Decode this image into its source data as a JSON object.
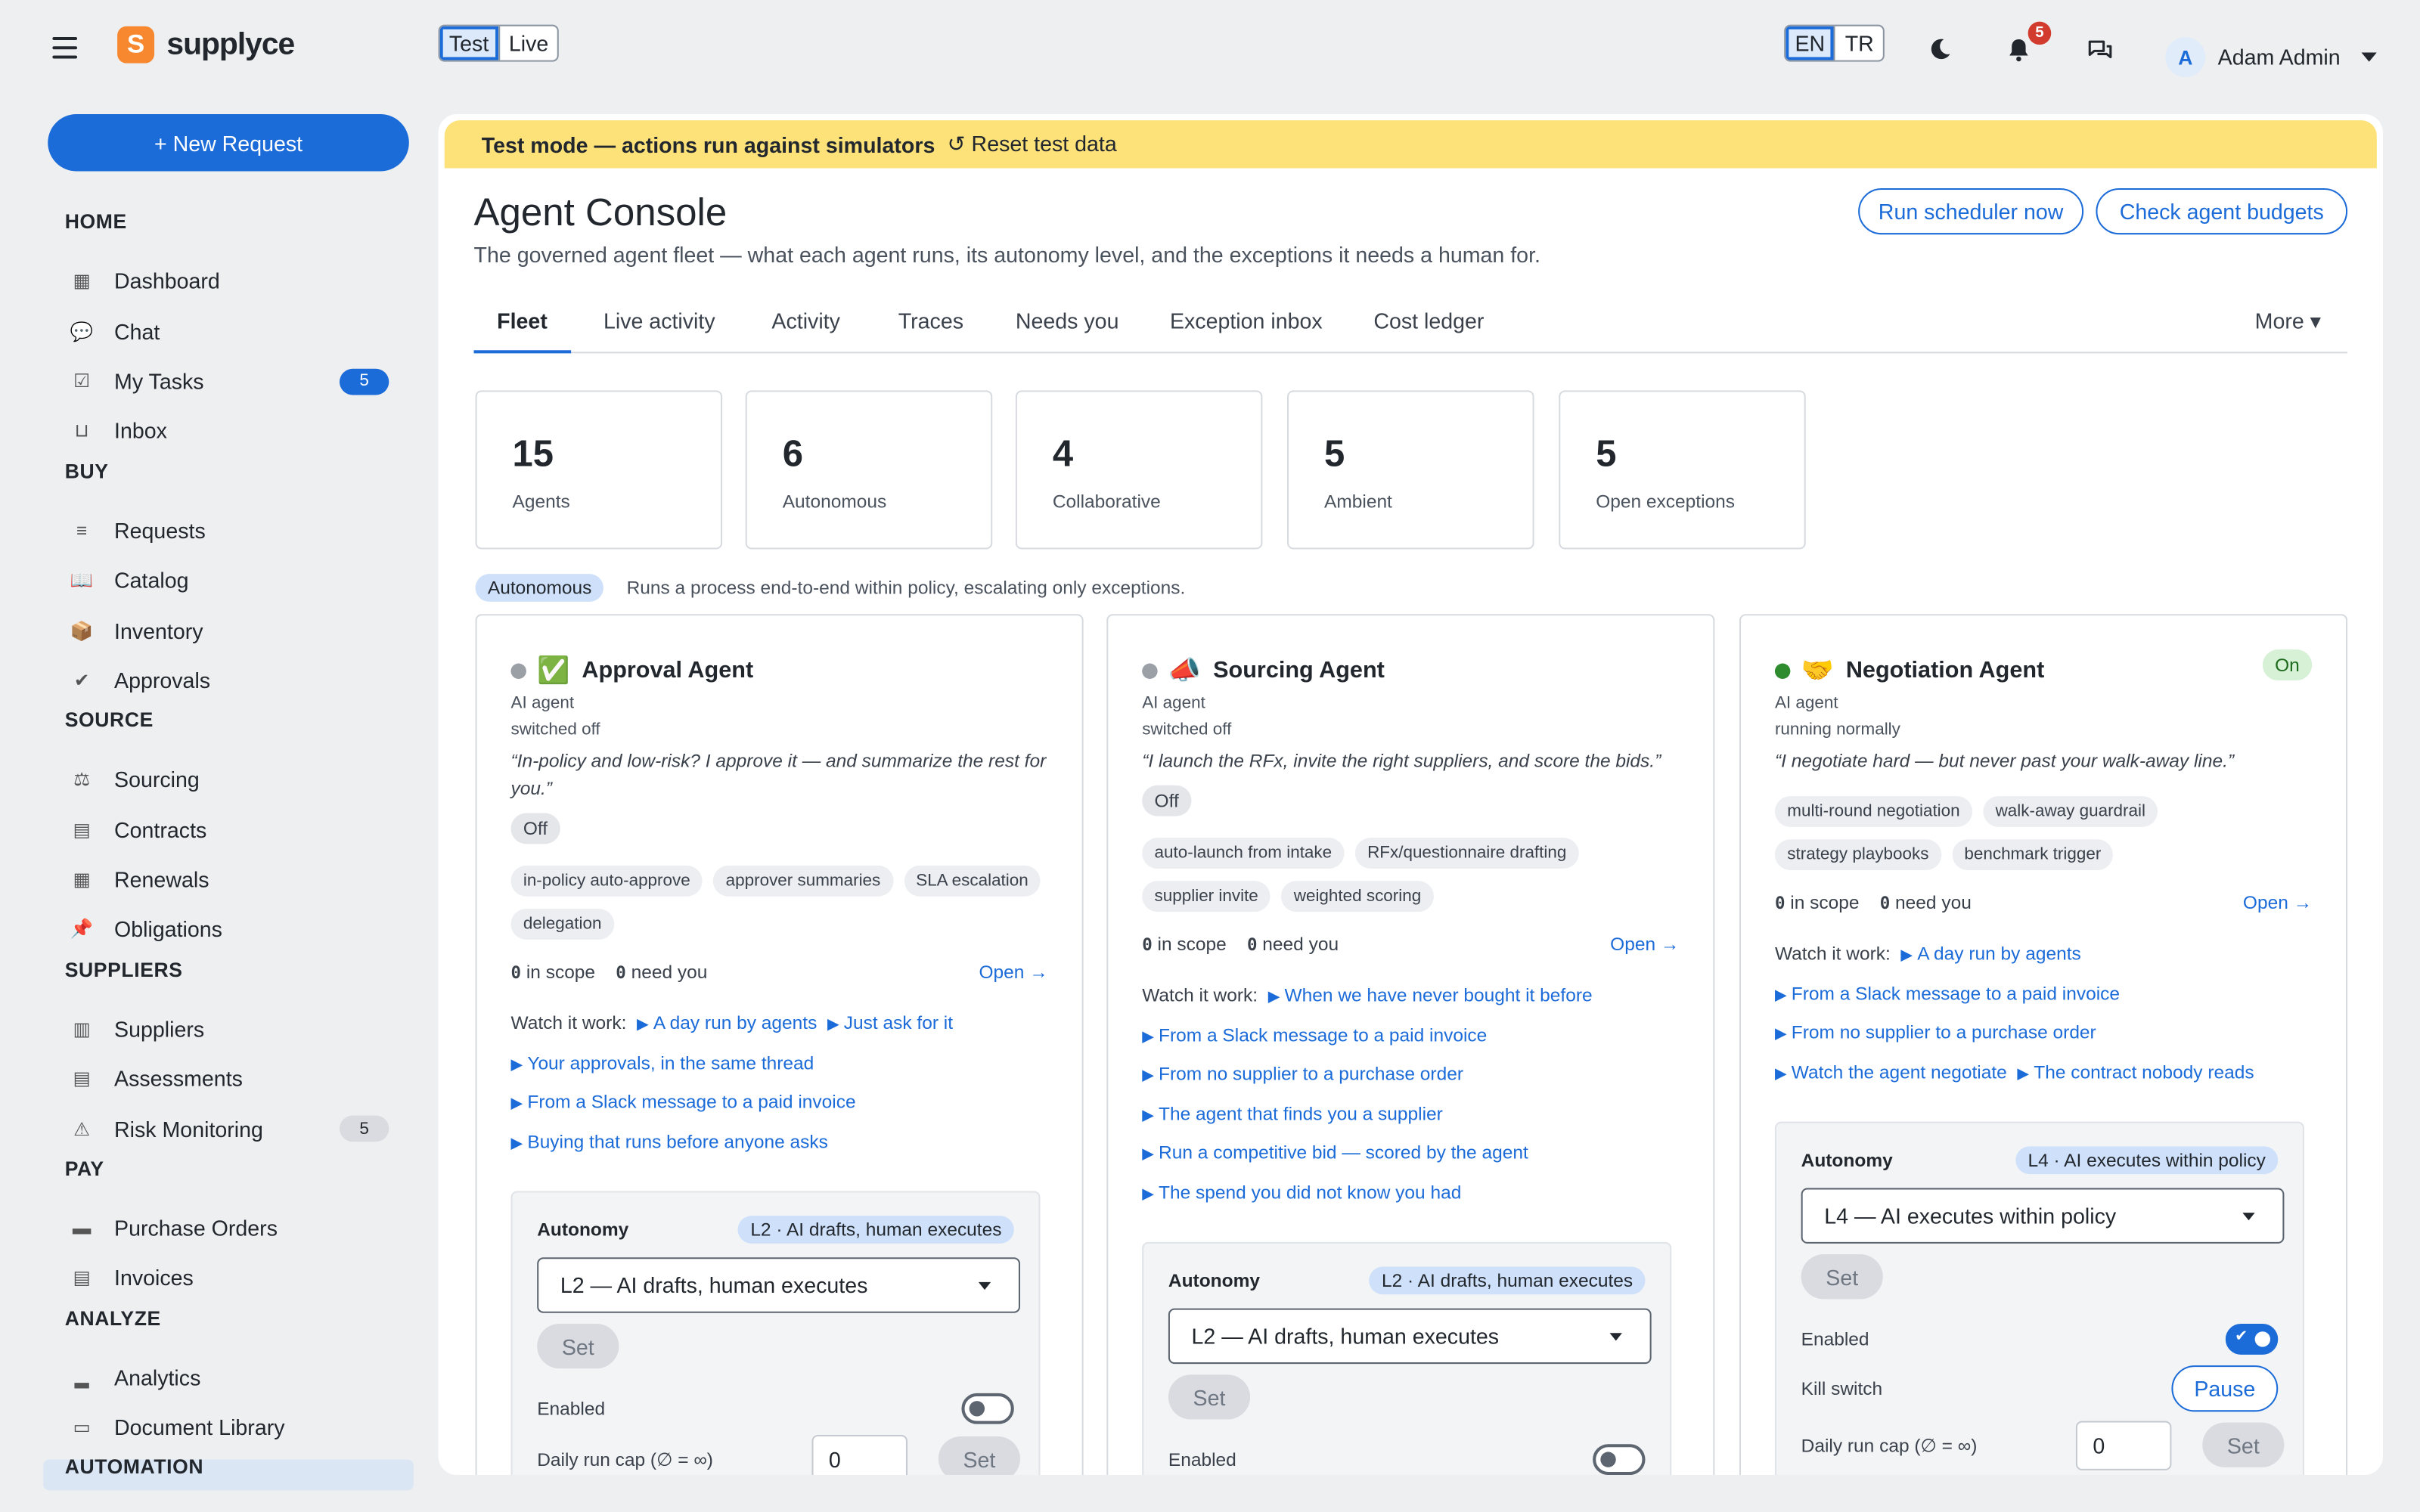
{
  "app": {
    "brand": "supplyce",
    "brand_letter": "S"
  },
  "topbar": {
    "env": [
      "Test",
      "Live"
    ],
    "lang": [
      "EN",
      "TR"
    ],
    "notification_count": "5",
    "user_initial": "A",
    "user_name": "Adam Admin"
  },
  "sidebar": {
    "new_request": "+ New Request",
    "sections": [
      {
        "heading": "HOME",
        "items": [
          {
            "label": "Dashboard",
            "icon": "grid-icon"
          },
          {
            "label": "Chat",
            "icon": "chat-icon"
          },
          {
            "label": "My Tasks",
            "icon": "checkbox-icon",
            "badge": "5"
          },
          {
            "label": "Inbox",
            "icon": "inbox-icon"
          }
        ]
      },
      {
        "heading": "BUY",
        "items": [
          {
            "label": "Requests",
            "icon": "list-icon"
          },
          {
            "label": "Catalog",
            "icon": "book-icon"
          },
          {
            "label": "Inventory",
            "icon": "box-icon"
          },
          {
            "label": "Approvals",
            "icon": "check-icon"
          }
        ]
      },
      {
        "heading": "SOURCE",
        "items": [
          {
            "label": "Sourcing",
            "icon": "scale-icon"
          },
          {
            "label": "Contracts",
            "icon": "document-icon"
          },
          {
            "label": "Renewals",
            "icon": "calendar-icon"
          },
          {
            "label": "Obligations",
            "icon": "pin-icon"
          }
        ]
      },
      {
        "heading": "SUPPLIERS",
        "items": [
          {
            "label": "Suppliers",
            "icon": "building-icon"
          },
          {
            "label": "Assessments",
            "icon": "clipboard-icon"
          },
          {
            "label": "Risk Monitoring",
            "icon": "warning-icon",
            "badge": "5"
          }
        ]
      },
      {
        "heading": "PAY",
        "items": [
          {
            "label": "Purchase Orders",
            "icon": "folder-icon"
          },
          {
            "label": "Invoices",
            "icon": "receipt-icon"
          }
        ]
      },
      {
        "heading": "ANALYZE",
        "items": [
          {
            "label": "Analytics",
            "icon": "bar-chart-icon"
          },
          {
            "label": "Document Library",
            "icon": "archive-icon"
          }
        ]
      },
      {
        "heading": "AUTOMATION",
        "items": []
      }
    ]
  },
  "banner": {
    "text": "Test mode — actions run against simulators",
    "reset": "↺ Reset test data"
  },
  "header": {
    "title": "Agent Console",
    "subtitle": "The governed agent fleet — what each agent runs, its autonomy level, and the exceptions it needs a human for.",
    "btn_scheduler": "Run scheduler now",
    "btn_budgets": "Check agent budgets"
  },
  "tabs": [
    "Fleet",
    "Live activity",
    "Activity",
    "Traces",
    "Needs you",
    "Exception inbox",
    "Cost ledger"
  ],
  "tab_more": "More ▾",
  "stats": [
    {
      "value": "15",
      "label": "Agents"
    },
    {
      "value": "6",
      "label": "Autonomous"
    },
    {
      "value": "4",
      "label": "Collaborative"
    },
    {
      "value": "5",
      "label": "Ambient"
    },
    {
      "value": "5",
      "label": "Open exceptions"
    }
  ],
  "group": {
    "pill": "Autonomous",
    "desc": "Runs a process end-to-end within policy, escalating only exceptions."
  },
  "common": {
    "ai_agent": "AI agent",
    "in_scope": " in scope",
    "need_you": " need you",
    "zero": "0",
    "open": "Open →",
    "watch": "Watch it work:",
    "autonomy": "Autonomy",
    "set": "Set",
    "enabled": "Enabled",
    "kill_switch": "Kill switch",
    "pause": "Pause",
    "daily_cap": "Daily run cap (∅ = ∞)",
    "cap_value": "0"
  },
  "agents": [
    {
      "name": "Approval Agent",
      "emoji": "✅",
      "status_color": "#9aa0a6",
      "status": "switched off",
      "quote": "“In-policy and low-risk? I approve it — and summarize the rest for you.”",
      "state_pill": "Off",
      "chips": [
        "in-policy auto-approve",
        "approver summaries",
        "SLA escalation",
        "delegation"
      ],
      "videos": [
        "A day run by agents",
        "Just ask for it",
        "Your approvals, in the same thread",
        "From a Slack message to a paid invoice",
        "Buying that runs before anyone asks"
      ],
      "level": "L2 · AI drafts, human executes",
      "select": "L2 — AI drafts, human executes"
    },
    {
      "name": "Sourcing Agent",
      "emoji": "📣",
      "status_color": "#9aa0a6",
      "status": "switched off",
      "quote": "“I launch the RFx, invite the right suppliers, and score the bids.”",
      "state_pill": "Off",
      "chips": [
        "auto-launch from intake",
        "RFx/questionnaire drafting",
        "supplier invite",
        "weighted scoring"
      ],
      "videos": [
        "When we have never bought it before",
        "From a Slack message to a paid invoice",
        "From no supplier to a purchase order",
        "The agent that finds you a supplier",
        "Run a competitive bid — scored by the agent",
        "The spend you did not know you had"
      ],
      "level": "L2 · AI drafts, human executes",
      "select": "L2 — AI drafts, human executes"
    },
    {
      "name": "Negotiation Agent",
      "emoji": "🤝",
      "status_color": "#2e8b2e",
      "status": "running normally",
      "quote": "“I negotiate hard — but never past your walk-away line.”",
      "state_pill": "On",
      "chips": [
        "multi-round negotiation",
        "walk-away guardrail",
        "strategy playbooks",
        "benchmark trigger"
      ],
      "videos": [
        "A day run by agents",
        "From a Slack message to a paid invoice",
        "From no supplier to a purchase order",
        "Watch the agent negotiate",
        "The contract nobody reads"
      ],
      "level": "L4 · AI executes within policy",
      "select": "L4 — AI executes within policy"
    }
  ],
  "colors": {
    "accent": "#1b6bd9",
    "banner": "#fde27a",
    "on_pill": "#d6f1d6"
  }
}
